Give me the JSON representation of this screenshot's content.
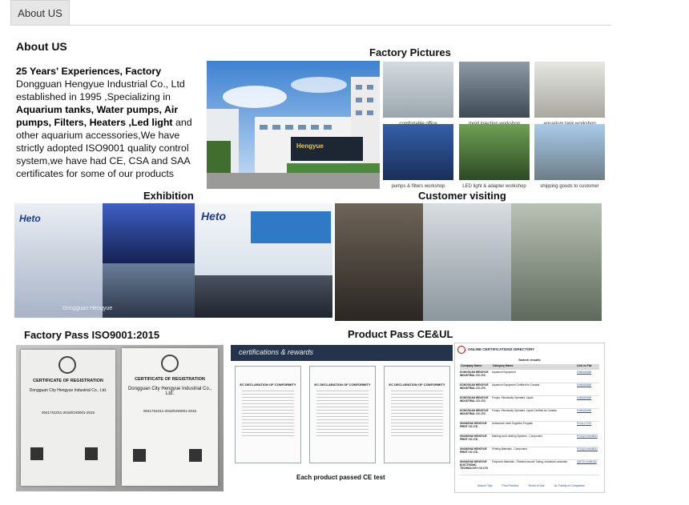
{
  "tab": {
    "label": "About US"
  },
  "about": {
    "title": "About US",
    "intro": {
      "p1_bold": "25 Years' Experiences, Factory",
      "p1_text": " Dongguan Hengyue Industrial Co., Ltd established in 1995 ,Specializing in ",
      "p2_bold": "Aquarium tanks, Water pumps, Air pumps, Filters, Heaters ,Led light",
      "p2_text": " and other aquarium accessories,We have strictly adopted ISO9001 quality control system,we have had CE, CSA and SAA certificates for some of our products"
    }
  },
  "sections": {
    "factory_pictures": "Factory Pictures",
    "exhibition": "Exhibition",
    "customer_visiting": "Customer visiting",
    "factory_pass": "Factory  Pass ISO9001:2015",
    "product_pass": "Product Pass CE&UL"
  },
  "factory_photos": [
    {
      "caption": "comfortable office"
    },
    {
      "caption": "mold injection workshop"
    },
    {
      "caption": "aquarium tank workshop"
    },
    {
      "caption": "pumps & filters workshop"
    },
    {
      "caption": "LED light & adapter workshop"
    },
    {
      "caption": "shipping goods to customer"
    }
  ],
  "factory_building_sign": "Hengyue",
  "exhibition_brand": "Heto",
  "exhibition_brand_small": "Heto",
  "exhibition_banner": "Dongguan Hengyue",
  "iso_certificates": [
    {
      "title": "CERTIFICATE OF REGISTRATION",
      "company": "Dongguan City Hengyue Industrial Co., Ltd.",
      "number": "00417S1011-2018/CN0001-2015"
    },
    {
      "title": "CERTIFICATE OF REGISTRATION",
      "company": "Dongguan City Hengyue Industrial Co., Ltd.",
      "number": "00417S1011-2018/CN0001-2015"
    }
  ],
  "ce_panel": {
    "header": "certifications & rewards",
    "doc_title": "EC DECLARATION OF CONFORMITY",
    "caption": "Each product passed CE test"
  },
  "ul_panel": {
    "header": "ONLINE CERTIFICATIONS DIRECTORY",
    "subheader": "Search results",
    "col_company": "Company Name",
    "col_category": "Category Name",
    "col_link": "Link to File",
    "rows": [
      {
        "company": "DONGGUAN HENGYUE INDUSTRIAL CO LTD",
        "category": "Aquarium Equipment",
        "link": "E468183458"
      },
      {
        "company": "DONGGUAN HENGYUE INDUSTRIAL CO LTD",
        "category": "Aquarium Equipment Certified for Canada",
        "link": "E468183458"
      },
      {
        "company": "DONGGUAN HENGYUE INDUSTRIAL CO LTD",
        "category": "Pumps, Electrically Operated, Liquid",
        "link": "E468183458"
      },
      {
        "company": "DONGGUAN HENGYUE INDUSTRIAL CO LTD",
        "category": "Pumps, Electrically Operated, Liquid Certified for Canada",
        "link": "E468183458"
      },
      {
        "company": "SHANGHAI HENGYUE PRINT CO LTD",
        "category": "Authorized Label Suppliers Program",
        "link": "PGGL2.PGS"
      },
      {
        "company": "SHANGHAI HENGYUE PRINT CO LTD",
        "category": "Marking and Labeling Systems - Component",
        "link": "PGDQ2.MH25831"
      },
      {
        "company": "SHANGHAI HENGYUE PRINT CO LTD",
        "category": "Printing Materials - Component",
        "link": "PGDQ2.MH25831"
      },
      {
        "company": "SHANGHAI HENGYUE ELECTRONIC TECHNOLOGY CO LTD",
        "category": "Polymeric Materials - Filament-wound Tubing, Industrial Laminates",
        "link": "QMTS2.E468183"
      }
    ],
    "footer_links": [
      "Search Tips",
      "Print Preview",
      "Terms of Use",
      "UL Family of Companies"
    ]
  }
}
